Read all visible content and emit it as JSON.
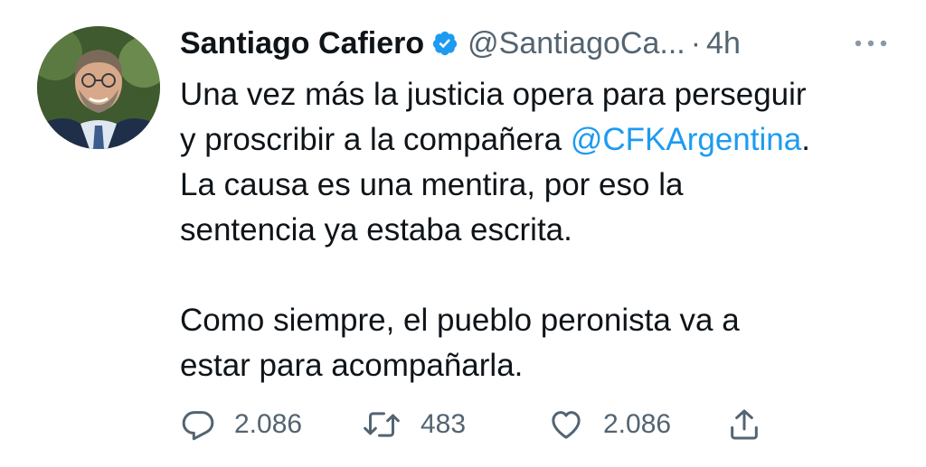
{
  "tweet": {
    "author_name": "Santiago Cafiero",
    "handle": "@SantiagoCa...",
    "dot": "·",
    "time": "4h",
    "verified": true,
    "body_lines": [
      "Una vez más la justicia opera para perseguir",
      "y proscribir a la compañera ",
      "@CFKArgentina",
      ".",
      "La causa es una mentira, por eso la",
      "sentencia ya estaba escrita.",
      "Como siempre, el pueblo peronista va a",
      "estar para acompañarla."
    ]
  },
  "actions": {
    "replies": "2.086",
    "retweets": "483",
    "likes": "2.086"
  },
  "colors": {
    "text": "#0f1419",
    "secondary": "#536471",
    "accent": "#1d9bf0"
  },
  "icons": {
    "verified": "verified-badge-icon",
    "more": "more-options-icon",
    "reply": "reply-icon",
    "retweet": "retweet-icon",
    "like": "heart-icon",
    "share": "share-icon"
  }
}
